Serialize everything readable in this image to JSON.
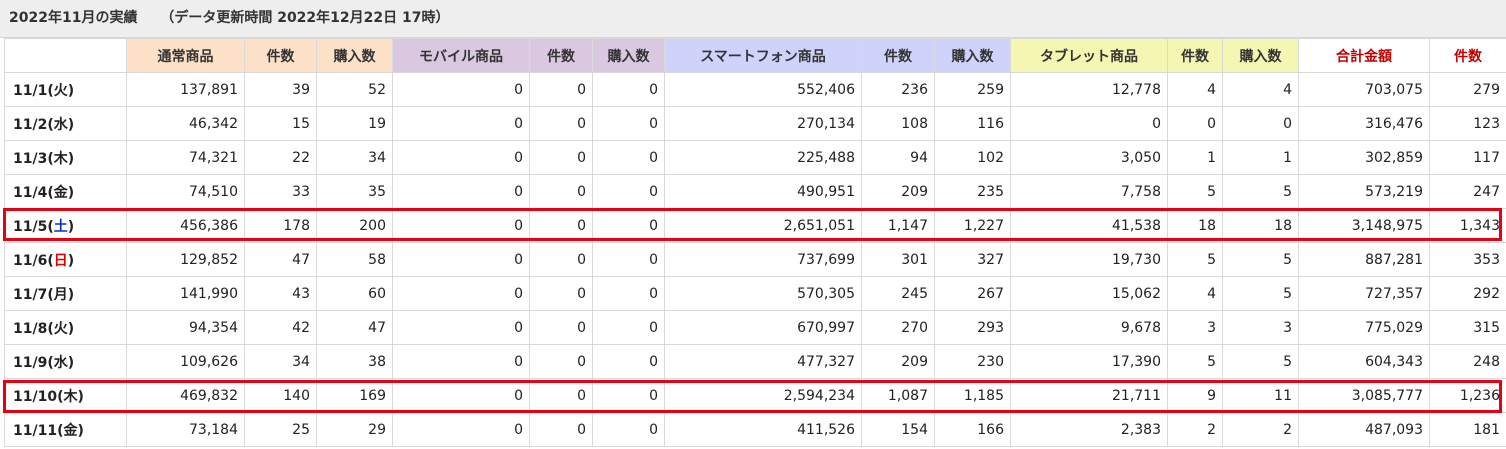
{
  "header": {
    "title": "2022年11月の実績",
    "update_label": "（データ更新時間 2022年12月22日 17時）"
  },
  "columns": {
    "normal": "通常商品",
    "normal_count": "件数",
    "normal_purchase": "購入数",
    "mobile": "モバイル商品",
    "mobile_count": "件数",
    "mobile_purchase": "購入数",
    "smart": "スマートフォン商品",
    "smart_count": "件数",
    "smart_purchase": "購入数",
    "tablet": "タブレット商品",
    "tablet_count": "件数",
    "tablet_purchase": "購入数",
    "total": "合計金額",
    "total_count": "件数"
  },
  "colors": {
    "normal_header": "#fde0c8",
    "mobile_header": "#d9c8e0",
    "smart_header": "#cfd2fb",
    "tablet_header": "#f3f7b1",
    "total_header_text": "#c00000",
    "highlight": "#e60012",
    "saturday": "#0033cc",
    "sunday": "#e00000"
  },
  "rows": [
    {
      "date": "11/1(",
      "day": "火",
      "close": ")",
      "cells": [
        "137,891",
        "39",
        "52",
        "0",
        "0",
        "0",
        "552,406",
        "236",
        "259",
        "12,778",
        "4",
        "4",
        "703,075",
        "279"
      ]
    },
    {
      "date": "11/2(",
      "day": "水",
      "close": ")",
      "cells": [
        "46,342",
        "15",
        "19",
        "0",
        "0",
        "0",
        "270,134",
        "108",
        "116",
        "0",
        "0",
        "0",
        "316,476",
        "123"
      ]
    },
    {
      "date": "11/3(",
      "day": "木",
      "close": ")",
      "cells": [
        "74,321",
        "22",
        "34",
        "0",
        "0",
        "0",
        "225,488",
        "94",
        "102",
        "3,050",
        "1",
        "1",
        "302,859",
        "117"
      ]
    },
    {
      "date": "11/4(",
      "day": "金",
      "close": ")",
      "cells": [
        "74,510",
        "33",
        "35",
        "0",
        "0",
        "0",
        "490,951",
        "209",
        "235",
        "7,758",
        "5",
        "5",
        "573,219",
        "247"
      ]
    },
    {
      "date": "11/5(",
      "day": "土",
      "close": ")",
      "cells": [
        "456,386",
        "178",
        "200",
        "0",
        "0",
        "0",
        "2,651,051",
        "1,147",
        "1,227",
        "41,538",
        "18",
        "18",
        "3,148,975",
        "1,343"
      ]
    },
    {
      "date": "11/6(",
      "day": "日",
      "close": ")",
      "cells": [
        "129,852",
        "47",
        "58",
        "0",
        "0",
        "0",
        "737,699",
        "301",
        "327",
        "19,730",
        "5",
        "5",
        "887,281",
        "353"
      ]
    },
    {
      "date": "11/7(",
      "day": "月",
      "close": ")",
      "cells": [
        "141,990",
        "43",
        "60",
        "0",
        "0",
        "0",
        "570,305",
        "245",
        "267",
        "15,062",
        "4",
        "5",
        "727,357",
        "292"
      ]
    },
    {
      "date": "11/8(",
      "day": "火",
      "close": ")",
      "cells": [
        "94,354",
        "42",
        "47",
        "0",
        "0",
        "0",
        "670,997",
        "270",
        "293",
        "9,678",
        "3",
        "3",
        "775,029",
        "315"
      ]
    },
    {
      "date": "11/9(",
      "day": "水",
      "close": ")",
      "cells": [
        "109,626",
        "34",
        "38",
        "0",
        "0",
        "0",
        "477,327",
        "209",
        "230",
        "17,390",
        "5",
        "5",
        "604,343",
        "248"
      ]
    },
    {
      "date": "11/10(",
      "day": "木",
      "close": ")",
      "cells": [
        "469,832",
        "140",
        "169",
        "0",
        "0",
        "0",
        "2,594,234",
        "1,087",
        "1,185",
        "21,711",
        "9",
        "11",
        "3,085,777",
        "1,236"
      ]
    },
    {
      "date": "11/11(",
      "day": "金",
      "close": ")",
      "cells": [
        "73,184",
        "25",
        "29",
        "0",
        "0",
        "0",
        "411,526",
        "154",
        "166",
        "2,383",
        "2",
        "2",
        "487,093",
        "181"
      ]
    }
  ],
  "highlighted_rows": [
    "11/5(土)",
    "11/10(木)"
  ]
}
